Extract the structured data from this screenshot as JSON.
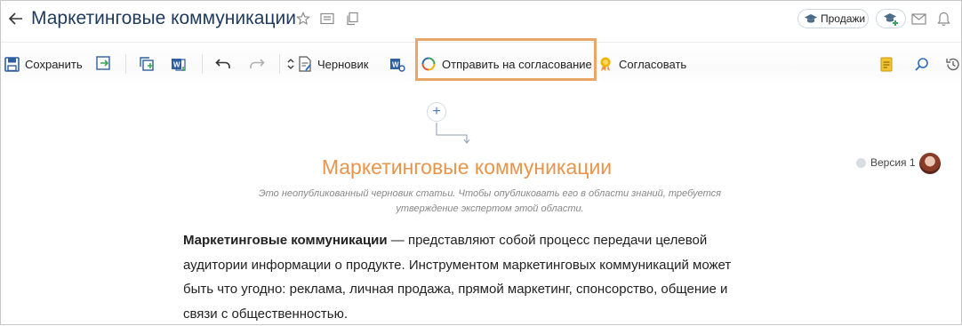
{
  "header": {
    "title": "Маркетинговые коммуникации",
    "back_icon": "arrow-left-icon",
    "sales_label": "Продажи"
  },
  "toolbar": {
    "save_label": "Сохранить",
    "draft_label": "Черновик",
    "send_label": "Отправить на согласование",
    "approve_label": "Согласовать"
  },
  "article": {
    "title": "Маркетинговые коммуникации",
    "draft_note_line1": "Это неопубликованный черновик статьи. Чтобы опубликовать его в области знаний, требуется",
    "draft_note_line2": "утверждение экспертом этой области.",
    "version_label": "Версия 1",
    "body_bold": "Маркетинговые коммуникации",
    "body_rest": " — представляют собой процесс передачи целевой аудитории информации о продукте. Инструментом маркетинговых коммуникаций может быть что угодно: реклама, личная продажа, прямой маркетинг, спонсорство, общение и связи с общественностью."
  },
  "colors": {
    "title_blue": "#1f3a5f",
    "accent_orange": "#e8954a",
    "highlight_orange": "#e8a667",
    "icon_blue": "#2f6db5"
  }
}
